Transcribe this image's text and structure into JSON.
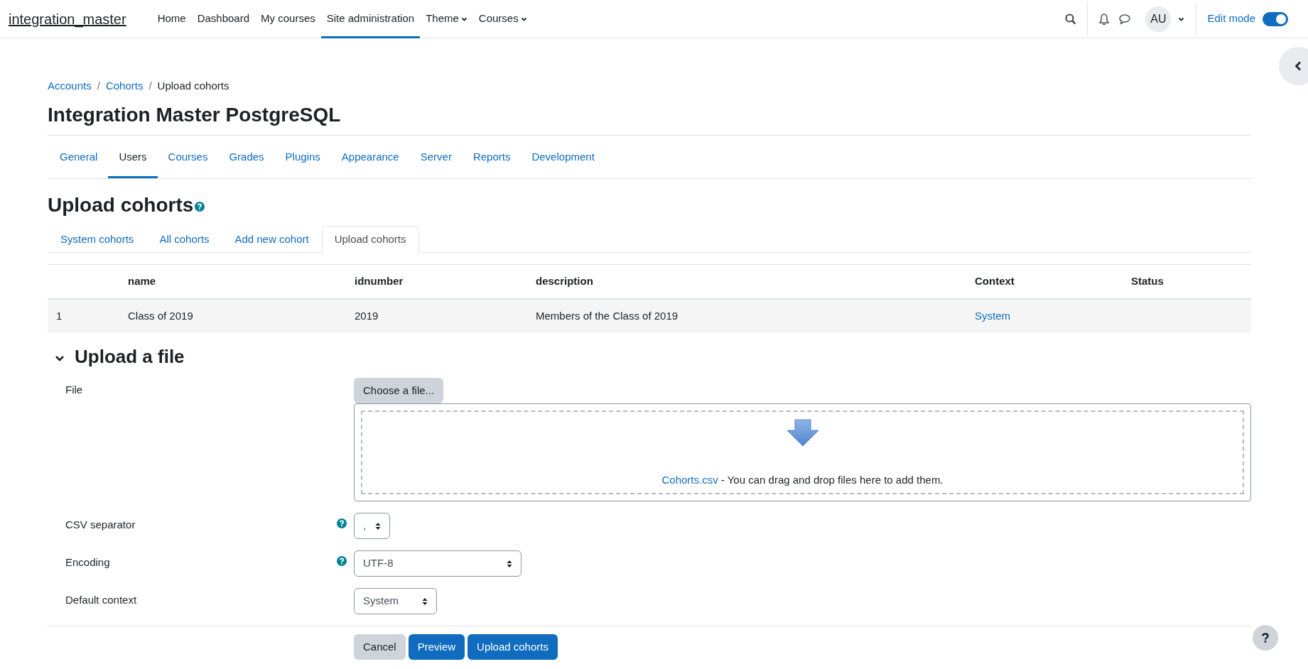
{
  "navbar": {
    "brand": "integration_master",
    "items": [
      {
        "label": "Home",
        "selected": false,
        "dropdown": false
      },
      {
        "label": "Dashboard",
        "selected": false,
        "dropdown": false
      },
      {
        "label": "My courses",
        "selected": false,
        "dropdown": false
      },
      {
        "label": "Site administration",
        "selected": true,
        "dropdown": false
      },
      {
        "label": "Theme",
        "selected": false,
        "dropdown": true
      },
      {
        "label": "Courses",
        "selected": false,
        "dropdown": true
      }
    ],
    "user_initials": "AU",
    "edit_mode": {
      "label": "Edit mode",
      "on": true
    }
  },
  "breadcrumb": {
    "separator": "/",
    "items": [
      "Accounts",
      "Cohorts",
      "Upload cohorts"
    ]
  },
  "site_title": "Integration Master PostgreSQL",
  "admin_tabs": [
    {
      "label": "General",
      "selected": false
    },
    {
      "label": "Users",
      "selected": true
    },
    {
      "label": "Courses",
      "selected": false
    },
    {
      "label": "Grades",
      "selected": false
    },
    {
      "label": "Plugins",
      "selected": false
    },
    {
      "label": "Appearance",
      "selected": false
    },
    {
      "label": "Server",
      "selected": false
    },
    {
      "label": "Reports",
      "selected": false
    },
    {
      "label": "Development",
      "selected": false
    }
  ],
  "page_heading": "Upload cohorts",
  "sub_tabs": [
    {
      "label": "System cohorts",
      "selected": false
    },
    {
      "label": "All cohorts",
      "selected": false
    },
    {
      "label": "Add new cohort",
      "selected": false
    },
    {
      "label": "Upload cohorts",
      "selected": true
    }
  ],
  "preview_table": {
    "columns": [
      "name",
      "idnumber",
      "description",
      "Context",
      "Status"
    ],
    "rows": [
      {
        "number": "1",
        "name": "Class of 2019",
        "idnumber": "2019",
        "description": "Members of the Class of 2019",
        "context": "System"
      }
    ]
  },
  "section": {
    "title": "Upload a file",
    "expanded": true
  },
  "file_field": {
    "label": "File",
    "button": "Choose a file...",
    "file_link": "Cohorts.csv",
    "drop_text": " - You can drag and drop files here to add them."
  },
  "select_fields": [
    {
      "label": "CSV separator",
      "help": true,
      "value": ",",
      "kind": "compact"
    },
    {
      "label": "Encoding",
      "help": true,
      "value": "UTF-8",
      "kind": "wide"
    },
    {
      "label": "Default context",
      "help": false,
      "value": "System",
      "kind": "medium"
    }
  ],
  "buttons": [
    {
      "label": "Cancel",
      "kind": "secondary"
    },
    {
      "label": "Preview",
      "kind": "primary"
    },
    {
      "label": "Upload cohorts",
      "kind": "primary"
    }
  ]
}
